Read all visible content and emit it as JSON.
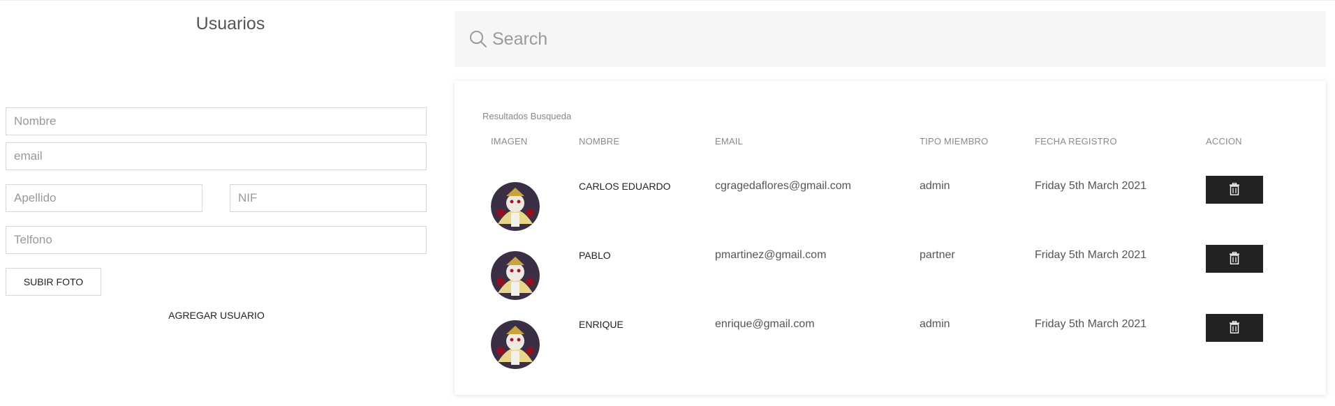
{
  "form": {
    "title": "Usuarios",
    "nombre_placeholder": "Nombre",
    "email_placeholder": "email",
    "apellido_placeholder": "Apellido",
    "nif_placeholder": "NIF",
    "telefono_placeholder": "Telfono",
    "upload_label": "SUBIR FOTO",
    "add_label": "AGREGAR USUARIO"
  },
  "search": {
    "placeholder": "Search",
    "icon": "search-icon"
  },
  "results": {
    "caption": "Resultados Busqueda",
    "headers": [
      "IMAGEN",
      "NOMBRE",
      "EMAIL",
      "TIPO MIEMBRO",
      "FECHA REGISTRO",
      "ACCION"
    ],
    "rows": [
      {
        "nombre": "CARLOS EDUARDO",
        "email": "cgragedaflores@gmail.com",
        "tipo": "admin",
        "fecha": "Friday 5th March 2021"
      },
      {
        "nombre": "PABLO",
        "email": "pmartinez@gmail.com",
        "tipo": "partner",
        "fecha": "Friday 5th March 2021"
      },
      {
        "nombre": "ENRIQUE",
        "email": "enrique@gmail.com",
        "tipo": "admin",
        "fecha": "Friday 5th March 2021"
      }
    ],
    "action_icon": "trash-icon"
  },
  "colors": {
    "delete_button": "#222222",
    "search_bg": "#f6f6f6",
    "border": "#d6d6d6"
  }
}
